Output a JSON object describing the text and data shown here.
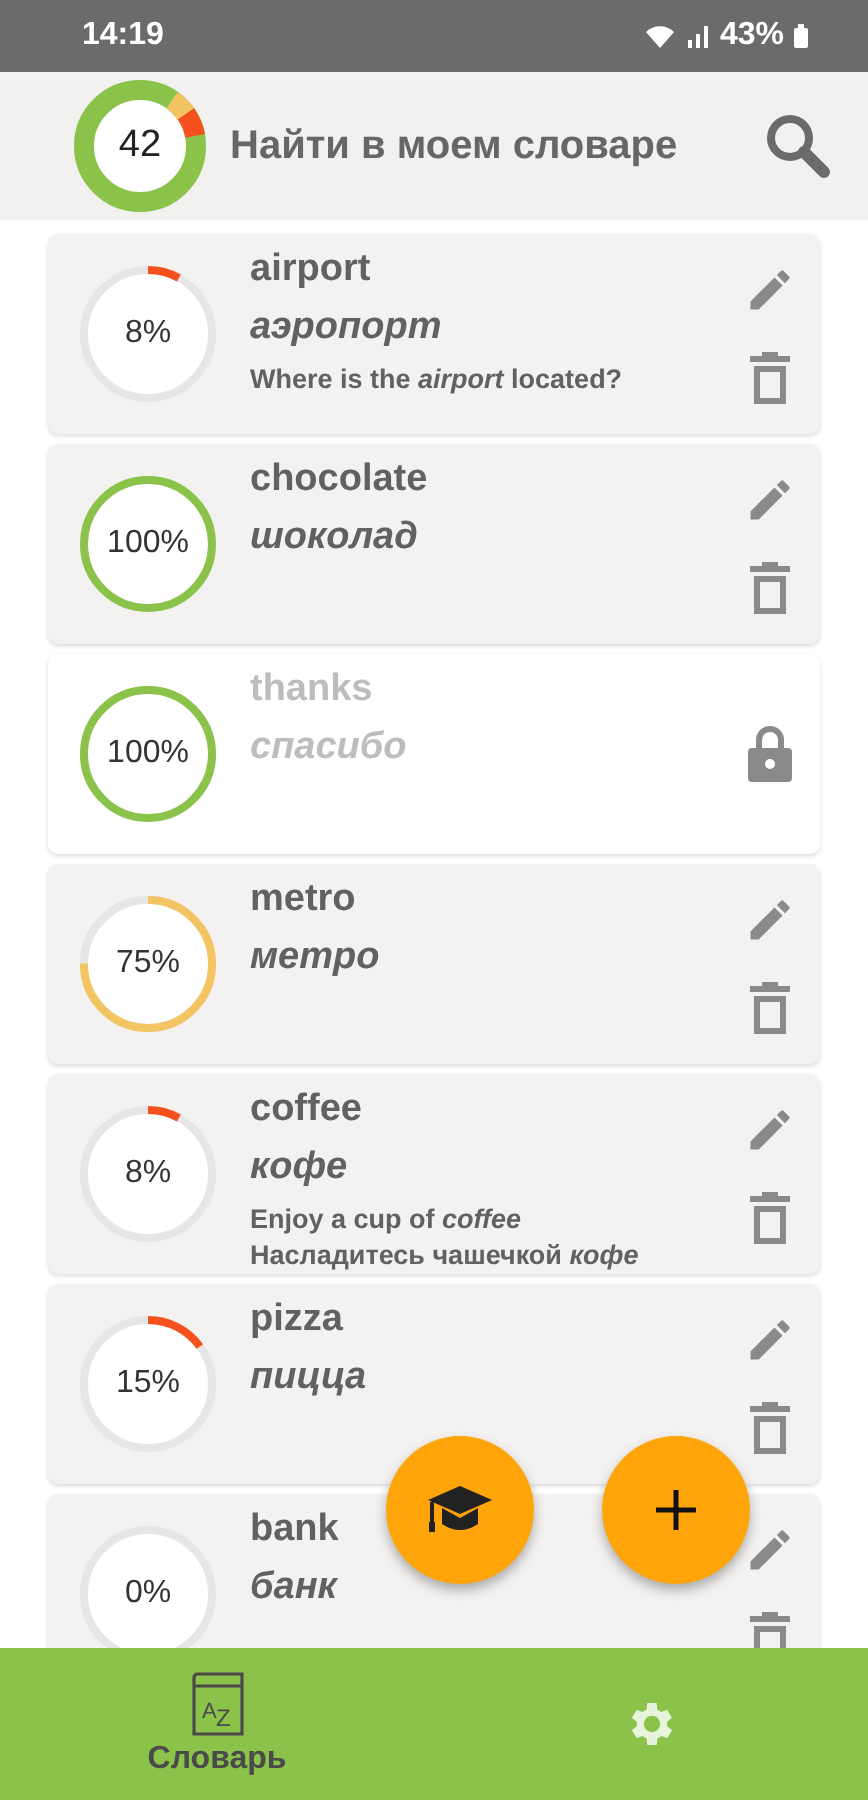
{
  "status_bar": {
    "time": "14:19",
    "battery": "43%"
  },
  "header": {
    "total": "42",
    "search_placeholder": "Найти в моем словаре"
  },
  "words": [
    {
      "word": "airport",
      "translation": "аэропорт",
      "examples": [
        "Where is the *airport* located?"
      ],
      "progress": "8%",
      "color": "#f4511e",
      "locked": false
    },
    {
      "word": "chocolate",
      "translation": "шоколад",
      "progress": "100%",
      "color": "#8bc34a",
      "locked": false
    },
    {
      "word": "thanks",
      "translation": "спасибо",
      "progress": "100%",
      "color": "#8bc34a",
      "locked": true
    },
    {
      "word": "metro",
      "translation": "метро",
      "progress": "75%",
      "color": "#f2c462",
      "locked": false
    },
    {
      "word": "coffee",
      "translation": "кофе",
      "examples": [
        "Enjoy a cup of *coffee*",
        "Насладитесь чашечкой *кофе*"
      ],
      "progress": "8%",
      "color": "#f4511e",
      "locked": false
    },
    {
      "word": "pizza",
      "translation": "пицца",
      "progress": "15%",
      "color": "#f4511e",
      "locked": false
    },
    {
      "word": "bank",
      "translation": "банк",
      "progress": "0%",
      "locked": false
    }
  ],
  "bottom_nav": [
    {
      "kind": "dictionary",
      "label": "Словарь",
      "icon_letters": [
        "A",
        "Z"
      ],
      "selected": true
    },
    {
      "kind": "settings",
      "selected": false
    }
  ]
}
